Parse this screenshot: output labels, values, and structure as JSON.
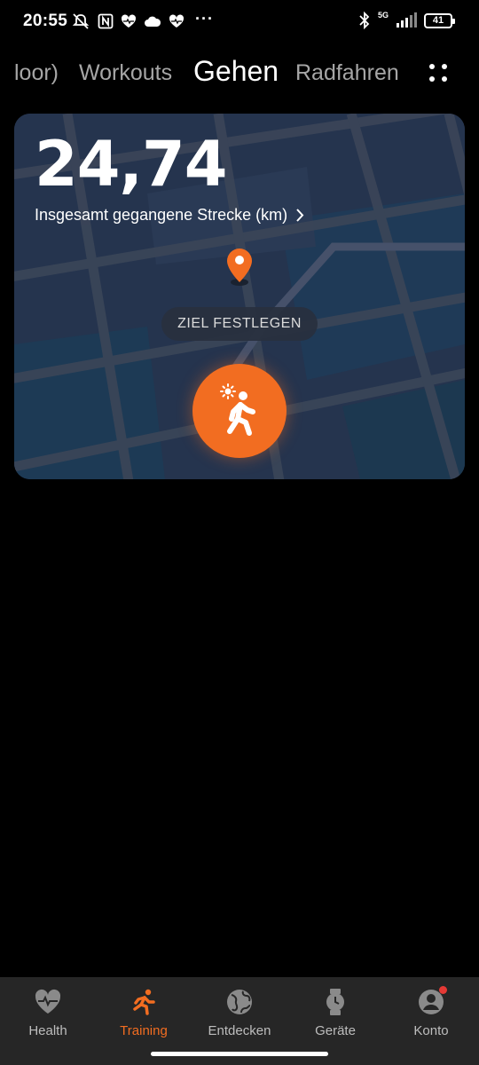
{
  "status_bar": {
    "time": "20:55",
    "network": "5G",
    "battery": "41",
    "icons": [
      "mute-icon",
      "nfc-icon",
      "heart-icon",
      "cloud-icon",
      "heart-icon",
      "more-dots-icon",
      "bluetooth-icon",
      "signal-icon"
    ]
  },
  "tabs": {
    "items": [
      {
        "label": "loor)",
        "active": false
      },
      {
        "label": "Workouts",
        "active": false
      },
      {
        "label": "Gehen",
        "active": true
      },
      {
        "label": "Radfahren",
        "active": false
      }
    ],
    "more_icon": "more-icon"
  },
  "card": {
    "distance_value": "24,74",
    "distance_label": "Insgesamt gegangene Strecke (km)",
    "goal_button": "ZIEL FESTLEGEN",
    "start_icon": "walking-icon",
    "pin_icon": "location-pin-icon"
  },
  "bottom_nav": {
    "items": [
      {
        "label": "Health",
        "icon": "heart-icon",
        "active": false
      },
      {
        "label": "Training",
        "icon": "running-icon",
        "active": true
      },
      {
        "label": "Entdecken",
        "icon": "globe-icon",
        "active": false
      },
      {
        "label": "Geräte",
        "icon": "watch-icon",
        "active": false
      },
      {
        "label": "Konto",
        "icon": "profile-icon",
        "active": false
      }
    ]
  },
  "colors": {
    "accent": "#f26d21",
    "nav_background": "#262626",
    "card_background": "#25344e",
    "notification_dot": "#e53935"
  }
}
